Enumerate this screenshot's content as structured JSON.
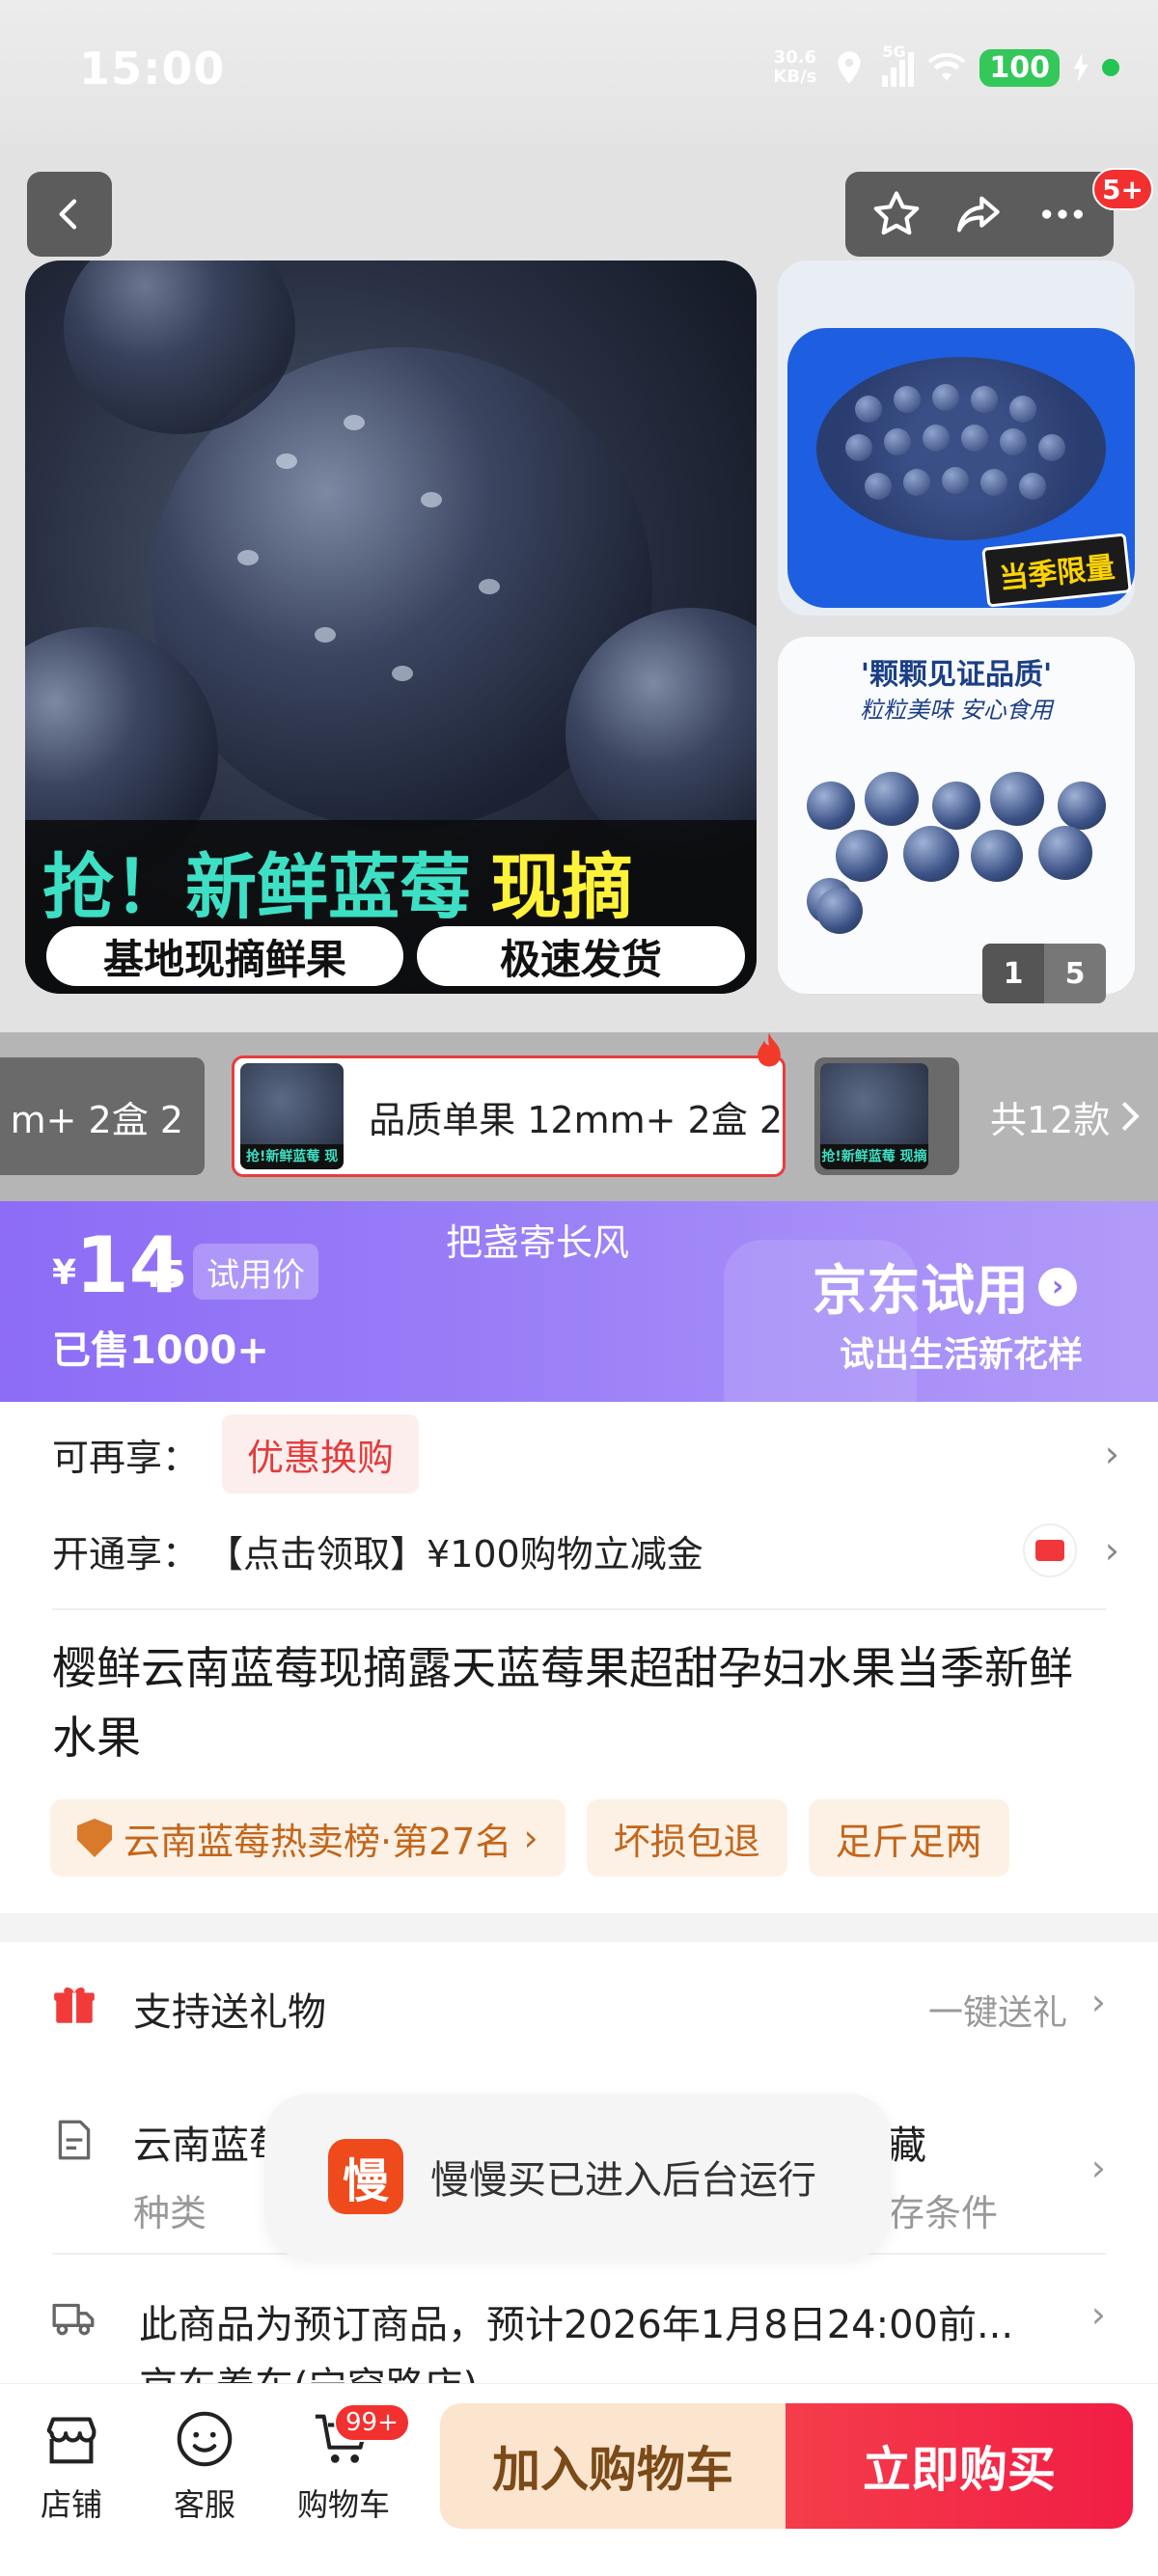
{
  "status_bar": {
    "time": "15:00",
    "net_speed_value": "30.6",
    "net_speed_unit": "KB/s",
    "network": "5G",
    "battery": "100"
  },
  "gallery": {
    "notification_badge": "5+",
    "main_image": {
      "headline": "抢！新鲜蓝莓",
      "headline_highlight": "现摘",
      "pill_left": "基地现摘鲜果",
      "pill_right": "极速发货"
    },
    "side_image_1": {
      "tag": "当季限量"
    },
    "side_image_2": {
      "line1": "'颗颗见证品质'",
      "line2": "粒粒美味 安心食用"
    },
    "counter": {
      "current": "1",
      "total": "5"
    }
  },
  "variants": {
    "prev_partial_label": "m+ 2盒 2",
    "selected_label": "品质单果 12mm+ 2盒 2",
    "thumb_text": "抢!新鲜蓝莓 现摘",
    "total_label": "共12款"
  },
  "price_banner": {
    "currency": "¥",
    "price_integer": "14",
    "price_decimal": ".5",
    "price_tag": "试用价",
    "center_text": "把盏寄长风",
    "sold_text": "已售1000+",
    "brand_title": "京东试用",
    "brand_slogan": "试出生活新花样"
  },
  "info": {
    "reenjoy_label": "可再享：",
    "reenjoy_chip": "优惠换购",
    "open_label": "开通享：",
    "open_text": "【点击领取】¥100购物立减金",
    "product_title": "樱鲜云南蓝莓现摘露天蓝莓果超甜孕妇水果当季新鲜水果",
    "tags": [
      "云南蓝莓热卖榜·第27名",
      "坏损包退",
      "足斤足两"
    ]
  },
  "services": {
    "gift_label": "支持送礼物",
    "gift_action": "一键送礼",
    "spec_label": "云南蓝莓",
    "spec_label_tail": "藏",
    "spec_sub": "种类",
    "spec_sub_tail": "存条件",
    "presale_text": "此商品为预订商品，预计2026年1月8日24:00前...",
    "presale_sub": "京东养车(宁穿路店)"
  },
  "toast": {
    "logo_char": "慢",
    "message": "慢慢买已进入后台运行"
  },
  "bottom_bar": {
    "store": "店铺",
    "service": "客服",
    "cart": "购物车",
    "cart_badge": "99+",
    "add_to_cart": "加入购物车",
    "buy_now": "立即购买"
  },
  "colors": {
    "accent_red": "#f23030",
    "trial_purple": "#8d6cf6",
    "tag_orange": "#c3661a"
  },
  "icons": [
    "back-arrow-icon",
    "star-icon",
    "share-icon",
    "more-icon",
    "fire-icon",
    "gift-icon",
    "document-icon",
    "truck-icon",
    "store-icon",
    "service-icon",
    "cart-icon",
    "coupon-icon"
  ]
}
